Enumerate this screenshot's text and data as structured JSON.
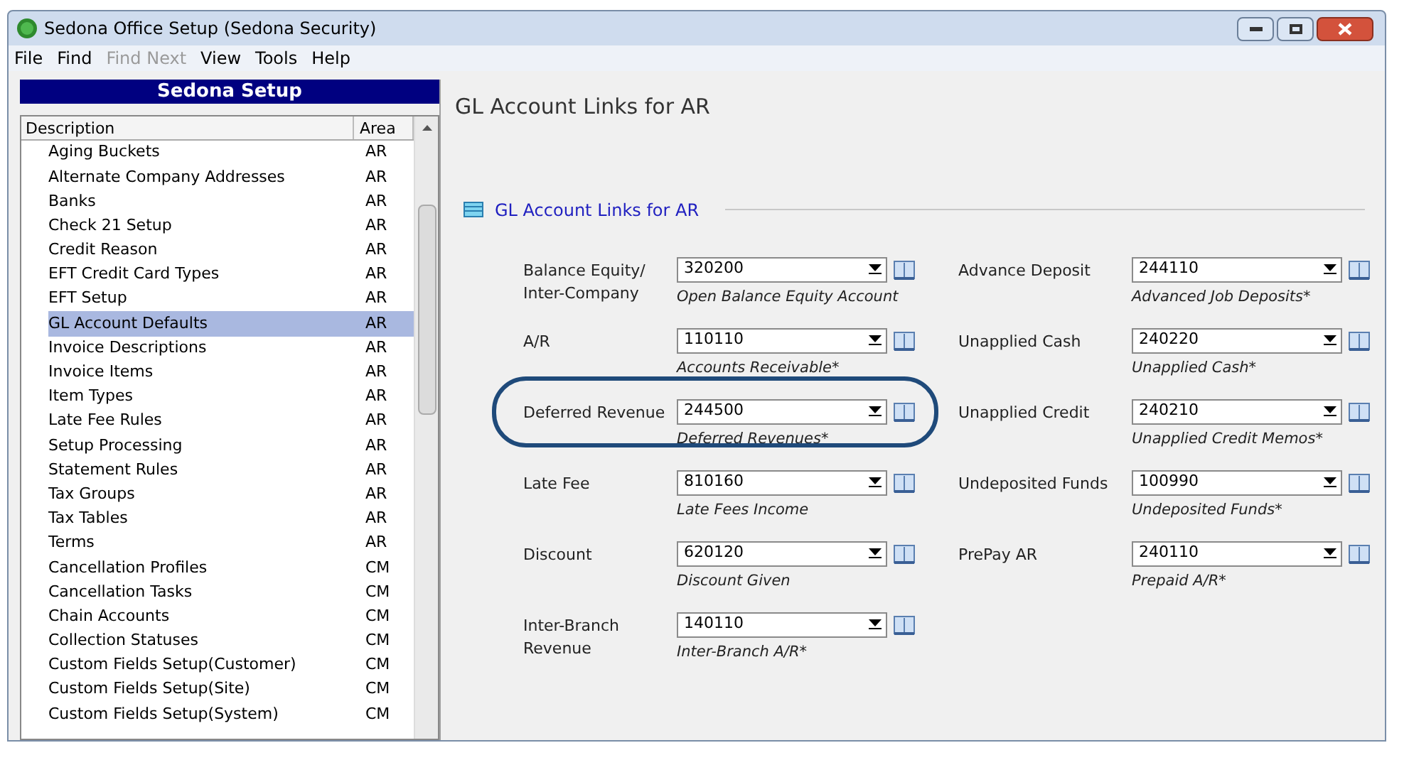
{
  "window": {
    "title": "Sedona Office Setup (Sedona Security)"
  },
  "menu": [
    {
      "label": "File",
      "disabled": false
    },
    {
      "label": "Find",
      "disabled": false
    },
    {
      "label": "Find Next",
      "disabled": true
    },
    {
      "label": "View",
      "disabled": false
    },
    {
      "label": "Tools",
      "disabled": false
    },
    {
      "label": "Help",
      "disabled": false
    }
  ],
  "sidebar": {
    "title": "Sedona Setup",
    "columns": [
      "Description",
      "Area"
    ],
    "rows": [
      {
        "description": "Aging Buckets",
        "area": "AR",
        "selected": false
      },
      {
        "description": "Alternate Company Addresses",
        "area": "AR",
        "selected": false
      },
      {
        "description": "Banks",
        "area": "AR",
        "selected": false
      },
      {
        "description": "Check 21 Setup",
        "area": "AR",
        "selected": false
      },
      {
        "description": "Credit Reason",
        "area": "AR",
        "selected": false
      },
      {
        "description": "EFT Credit Card Types",
        "area": "AR",
        "selected": false
      },
      {
        "description": "EFT Setup",
        "area": "AR",
        "selected": false
      },
      {
        "description": "GL Account Defaults",
        "area": "AR",
        "selected": true
      },
      {
        "description": "Invoice Descriptions",
        "area": "AR",
        "selected": false
      },
      {
        "description": "Invoice Items",
        "area": "AR",
        "selected": false
      },
      {
        "description": "Item Types",
        "area": "AR",
        "selected": false
      },
      {
        "description": "Late Fee Rules",
        "area": "AR",
        "selected": false
      },
      {
        "description": "Setup Processing",
        "area": "AR",
        "selected": false
      },
      {
        "description": "Statement Rules",
        "area": "AR",
        "selected": false
      },
      {
        "description": "Tax Groups",
        "area": "AR",
        "selected": false
      },
      {
        "description": "Tax Tables",
        "area": "AR",
        "selected": false
      },
      {
        "description": "Terms",
        "area": "AR",
        "selected": false
      },
      {
        "description": "Cancellation Profiles",
        "area": "CM",
        "selected": false
      },
      {
        "description": "Cancellation Tasks",
        "area": "CM",
        "selected": false
      },
      {
        "description": "Chain Accounts",
        "area": "CM",
        "selected": false
      },
      {
        "description": "Collection Statuses",
        "area": "CM",
        "selected": false
      },
      {
        "description": "Custom Fields Setup(Customer)",
        "area": "CM",
        "selected": false
      },
      {
        "description": "Custom Fields Setup(Site)",
        "area": "CM",
        "selected": false
      },
      {
        "description": "Custom Fields Setup(System)",
        "area": "CM",
        "selected": false
      }
    ]
  },
  "content": {
    "title": "GL Account Links for AR",
    "section": "GL Account Links for AR",
    "left_fields": [
      {
        "label": "Balance Equity/ Inter-Company",
        "value": "320200",
        "description": "Open Balance Equity Account",
        "highlighted": false
      },
      {
        "label": "A/R",
        "value": "110110",
        "description": "Accounts Receivable*",
        "highlighted": false
      },
      {
        "label": "Deferred Revenue",
        "value": "244500",
        "description": "Deferred Revenues*",
        "highlighted": true
      },
      {
        "label": "Late Fee",
        "value": "810160",
        "description": "Late Fees Income",
        "highlighted": false
      },
      {
        "label": "Discount",
        "value": "620120",
        "description": "Discount Given",
        "highlighted": false
      },
      {
        "label": "Inter-Branch Revenue",
        "value": "140110",
        "description": "Inter-Branch A/R*",
        "highlighted": false
      }
    ],
    "right_fields": [
      {
        "label": "Advance Deposit",
        "value": "244110",
        "description": "Advanced Job Deposits*",
        "highlighted": false
      },
      {
        "label": "Unapplied Cash",
        "value": "240220",
        "description": "Unapplied Cash*",
        "highlighted": false
      },
      {
        "label": "Unapplied Credit",
        "value": "240210",
        "description": "Unapplied Credit Memos*",
        "highlighted": false
      },
      {
        "label": "Undeposited Funds",
        "value": "100990",
        "description": "Undeposited Funds*",
        "highlighted": false
      },
      {
        "label": "PrePay AR",
        "value": "240110",
        "description": "Prepaid A/R*",
        "highlighted": false
      }
    ]
  }
}
